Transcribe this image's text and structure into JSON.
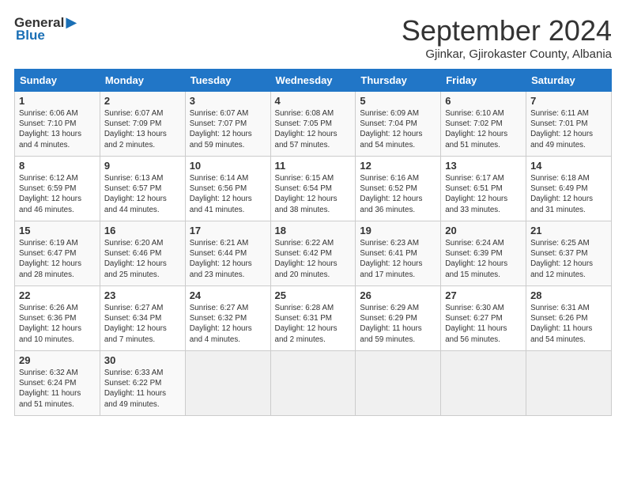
{
  "header": {
    "logo_general": "General",
    "logo_blue": "Blue",
    "month_title": "September 2024",
    "location": "Gjinkar, Gjirokaster County, Albania"
  },
  "days_of_week": [
    "Sunday",
    "Monday",
    "Tuesday",
    "Wednesday",
    "Thursday",
    "Friday",
    "Saturday"
  ],
  "weeks": [
    [
      {
        "day": 1,
        "detail": "Sunrise: 6:06 AM\nSunset: 7:10 PM\nDaylight: 13 hours\nand 4 minutes."
      },
      {
        "day": 2,
        "detail": "Sunrise: 6:07 AM\nSunset: 7:09 PM\nDaylight: 13 hours\nand 2 minutes."
      },
      {
        "day": 3,
        "detail": "Sunrise: 6:07 AM\nSunset: 7:07 PM\nDaylight: 12 hours\nand 59 minutes."
      },
      {
        "day": 4,
        "detail": "Sunrise: 6:08 AM\nSunset: 7:05 PM\nDaylight: 12 hours\nand 57 minutes."
      },
      {
        "day": 5,
        "detail": "Sunrise: 6:09 AM\nSunset: 7:04 PM\nDaylight: 12 hours\nand 54 minutes."
      },
      {
        "day": 6,
        "detail": "Sunrise: 6:10 AM\nSunset: 7:02 PM\nDaylight: 12 hours\nand 51 minutes."
      },
      {
        "day": 7,
        "detail": "Sunrise: 6:11 AM\nSunset: 7:01 PM\nDaylight: 12 hours\nand 49 minutes."
      }
    ],
    [
      {
        "day": 8,
        "detail": "Sunrise: 6:12 AM\nSunset: 6:59 PM\nDaylight: 12 hours\nand 46 minutes."
      },
      {
        "day": 9,
        "detail": "Sunrise: 6:13 AM\nSunset: 6:57 PM\nDaylight: 12 hours\nand 44 minutes."
      },
      {
        "day": 10,
        "detail": "Sunrise: 6:14 AM\nSunset: 6:56 PM\nDaylight: 12 hours\nand 41 minutes."
      },
      {
        "day": 11,
        "detail": "Sunrise: 6:15 AM\nSunset: 6:54 PM\nDaylight: 12 hours\nand 38 minutes."
      },
      {
        "day": 12,
        "detail": "Sunrise: 6:16 AM\nSunset: 6:52 PM\nDaylight: 12 hours\nand 36 minutes."
      },
      {
        "day": 13,
        "detail": "Sunrise: 6:17 AM\nSunset: 6:51 PM\nDaylight: 12 hours\nand 33 minutes."
      },
      {
        "day": 14,
        "detail": "Sunrise: 6:18 AM\nSunset: 6:49 PM\nDaylight: 12 hours\nand 31 minutes."
      }
    ],
    [
      {
        "day": 15,
        "detail": "Sunrise: 6:19 AM\nSunset: 6:47 PM\nDaylight: 12 hours\nand 28 minutes."
      },
      {
        "day": 16,
        "detail": "Sunrise: 6:20 AM\nSunset: 6:46 PM\nDaylight: 12 hours\nand 25 minutes."
      },
      {
        "day": 17,
        "detail": "Sunrise: 6:21 AM\nSunset: 6:44 PM\nDaylight: 12 hours\nand 23 minutes."
      },
      {
        "day": 18,
        "detail": "Sunrise: 6:22 AM\nSunset: 6:42 PM\nDaylight: 12 hours\nand 20 minutes."
      },
      {
        "day": 19,
        "detail": "Sunrise: 6:23 AM\nSunset: 6:41 PM\nDaylight: 12 hours\nand 17 minutes."
      },
      {
        "day": 20,
        "detail": "Sunrise: 6:24 AM\nSunset: 6:39 PM\nDaylight: 12 hours\nand 15 minutes."
      },
      {
        "day": 21,
        "detail": "Sunrise: 6:25 AM\nSunset: 6:37 PM\nDaylight: 12 hours\nand 12 minutes."
      }
    ],
    [
      {
        "day": 22,
        "detail": "Sunrise: 6:26 AM\nSunset: 6:36 PM\nDaylight: 12 hours\nand 10 minutes."
      },
      {
        "day": 23,
        "detail": "Sunrise: 6:27 AM\nSunset: 6:34 PM\nDaylight: 12 hours\nand 7 minutes."
      },
      {
        "day": 24,
        "detail": "Sunrise: 6:27 AM\nSunset: 6:32 PM\nDaylight: 12 hours\nand 4 minutes."
      },
      {
        "day": 25,
        "detail": "Sunrise: 6:28 AM\nSunset: 6:31 PM\nDaylight: 12 hours\nand 2 minutes."
      },
      {
        "day": 26,
        "detail": "Sunrise: 6:29 AM\nSunset: 6:29 PM\nDaylight: 11 hours\nand 59 minutes."
      },
      {
        "day": 27,
        "detail": "Sunrise: 6:30 AM\nSunset: 6:27 PM\nDaylight: 11 hours\nand 56 minutes."
      },
      {
        "day": 28,
        "detail": "Sunrise: 6:31 AM\nSunset: 6:26 PM\nDaylight: 11 hours\nand 54 minutes."
      }
    ],
    [
      {
        "day": 29,
        "detail": "Sunrise: 6:32 AM\nSunset: 6:24 PM\nDaylight: 11 hours\nand 51 minutes."
      },
      {
        "day": 30,
        "detail": "Sunrise: 6:33 AM\nSunset: 6:22 PM\nDaylight: 11 hours\nand 49 minutes."
      },
      {
        "day": null,
        "detail": ""
      },
      {
        "day": null,
        "detail": ""
      },
      {
        "day": null,
        "detail": ""
      },
      {
        "day": null,
        "detail": ""
      },
      {
        "day": null,
        "detail": ""
      }
    ]
  ]
}
